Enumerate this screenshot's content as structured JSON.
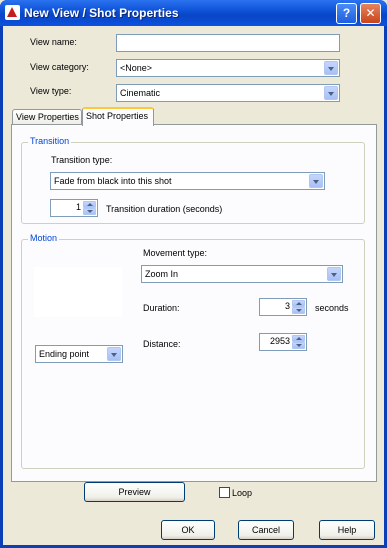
{
  "window": {
    "title": "New View / Shot Properties",
    "help_glyph": "?",
    "close_glyph": "✕"
  },
  "general": {
    "view_name_label": "View name:",
    "view_name_value": "",
    "view_category_label": "View category:",
    "view_category_value": "<None>",
    "view_type_label": "View type:",
    "view_type_value": "Cinematic"
  },
  "tabs": [
    {
      "label": "View Properties",
      "active": false
    },
    {
      "label": "Shot Properties",
      "active": true
    }
  ],
  "transition": {
    "group_title": "Transition",
    "type_label": "Transition type:",
    "type_value": "Fade from black into this shot",
    "duration_value": "1",
    "duration_label": "Transition duration (seconds)"
  },
  "motion": {
    "group_title": "Motion",
    "movement_type_label": "Movement type:",
    "movement_type_value": "Zoom In",
    "duration_label": "Duration:",
    "duration_value": "3",
    "duration_unit": "seconds",
    "distance_label": "Distance:",
    "distance_value": "2953",
    "point_select_value": "Ending point"
  },
  "preview": {
    "button_label": "Preview",
    "loop_label": "Loop",
    "loop_checked": false
  },
  "footer": {
    "ok_label": "OK",
    "cancel_label": "Cancel",
    "help_label": "Help"
  },
  "colors": {
    "titlebar": "#0a45c6",
    "group_title": "#0046d5",
    "tab_highlight": "#ffc83c"
  }
}
